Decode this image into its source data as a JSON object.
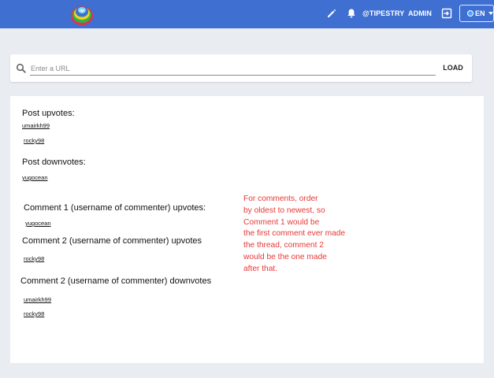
{
  "header": {
    "handle": "@TIPESTRY",
    "role": "ADMIN",
    "language": "EN",
    "colors": {
      "bar": "#3f6fd1"
    },
    "icons": [
      "app-logo-icon",
      "pencil-icon",
      "bell-icon",
      "logout-icon",
      "globe-icon",
      "chevron-down-icon"
    ]
  },
  "url_bar": {
    "placeholder": "Enter a URL",
    "value": "",
    "load_label": "LOAD"
  },
  "content": {
    "post_upvotes_title": "Post upvotes:",
    "post_upvotes": [
      "umairkh99",
      "rocky98"
    ],
    "post_downvotes_title": "Post downvotes:",
    "post_downvotes": [
      "yugocean"
    ],
    "comment1_upvotes_title": "Comment 1 (username of commenter) upvotes:",
    "comment1_upvotes": [
      "yugocean"
    ],
    "comment2_upvotes_title": "Comment 2 (username of commenter) upvotes",
    "comment2_upvotes": [
      "rocky98"
    ],
    "comment2_downvotes_title": "Comment 2 (username of commenter) downvotes",
    "comment2_downvotes": [
      "umairkh99",
      "rocky98"
    ]
  },
  "note": {
    "lines": [
      "For comments, order",
      "by oldest to newest, so",
      "Comment 1 would be",
      "the first comment ever made",
      "the thread, comment 2",
      "would be the one made",
      "after that."
    ],
    "color": "#e53935"
  }
}
